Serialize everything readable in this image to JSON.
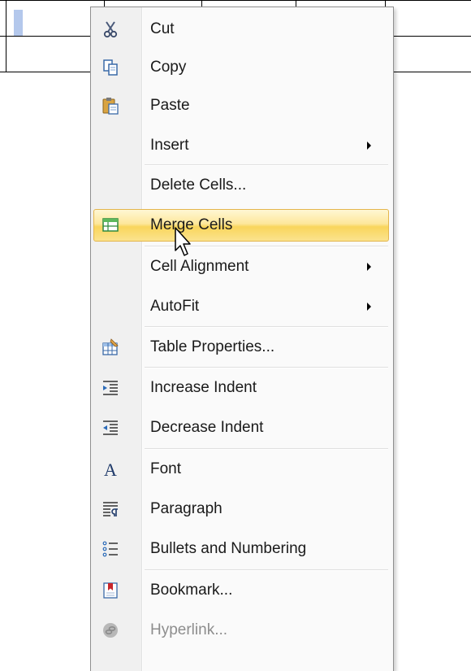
{
  "menu": {
    "items": [
      {
        "label": "Cut",
        "icon": "scissors-icon",
        "submenu": false,
        "enabled": true
      },
      {
        "label": "Copy",
        "icon": "copy-icon",
        "submenu": false,
        "enabled": true
      },
      {
        "label": "Paste",
        "icon": "paste-icon",
        "submenu": false,
        "enabled": true
      },
      {
        "label": "Insert",
        "icon": null,
        "submenu": true,
        "enabled": true
      },
      {
        "label": "Delete Cells...",
        "icon": null,
        "submenu": false,
        "enabled": true
      },
      {
        "label": "Merge Cells",
        "icon": "merge-cells-icon",
        "submenu": false,
        "enabled": true,
        "highlighted": true
      },
      {
        "label": "Cell Alignment",
        "icon": null,
        "submenu": true,
        "enabled": true
      },
      {
        "label": "AutoFit",
        "icon": null,
        "submenu": true,
        "enabled": true
      },
      {
        "label": "Table Properties...",
        "icon": "table-properties-icon",
        "submenu": false,
        "enabled": true
      },
      {
        "label": "Increase Indent",
        "icon": "increase-indent-icon",
        "submenu": false,
        "enabled": true
      },
      {
        "label": "Decrease Indent",
        "icon": "decrease-indent-icon",
        "submenu": false,
        "enabled": true
      },
      {
        "label": "Font",
        "icon": "font-icon",
        "submenu": false,
        "enabled": true
      },
      {
        "label": "Paragraph",
        "icon": "paragraph-icon",
        "submenu": false,
        "enabled": true
      },
      {
        "label": "Bullets and Numbering",
        "icon": "bullets-icon",
        "submenu": false,
        "enabled": true
      },
      {
        "label": "Bookmark...",
        "icon": "bookmark-icon",
        "submenu": false,
        "enabled": true
      },
      {
        "label": "Hyperlink...",
        "icon": "hyperlink-icon",
        "submenu": false,
        "enabled": false
      }
    ]
  },
  "colors": {
    "highlight_border": "#e4b64d",
    "highlight_fill": "#fde79b",
    "gutter": "#f0f0f0",
    "disabled_text": "#8d8d8d"
  }
}
